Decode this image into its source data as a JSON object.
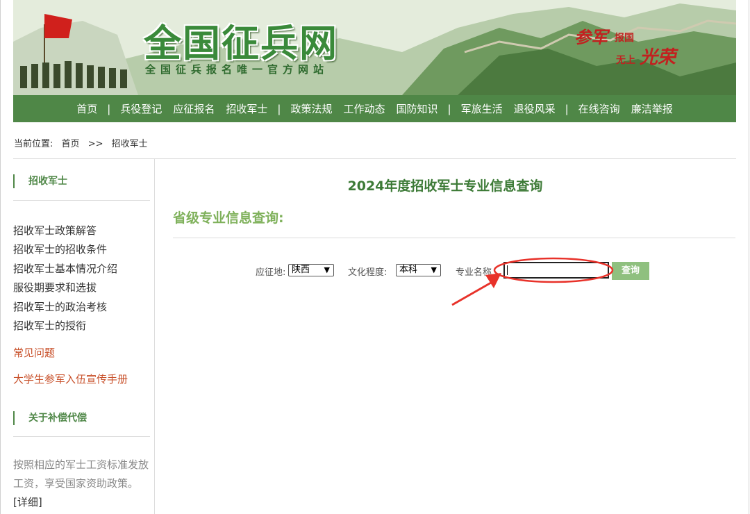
{
  "banner": {
    "site_title": "全国征兵网",
    "site_subtitle": "全国征兵报名唯一官方网站",
    "slogan_canjun": "参军",
    "slogan_baoguo": "报国",
    "slogan_wushang": "无上",
    "slogan_guangrong": "光荣"
  },
  "nav": {
    "items": [
      "首页",
      "兵役登记",
      "应征报名",
      "招收军士",
      "政策法规",
      "工作动态",
      "国防知识",
      "军旅生活",
      "退役风采",
      "在线咨询",
      "廉洁举报"
    ],
    "separator": "|"
  },
  "breadcrumb": {
    "label": "当前位置:",
    "home": "首页",
    "sep": ">>",
    "current": "招收军士"
  },
  "sidebar": {
    "section1_title": "招收军士",
    "links": [
      "招收军士政策解答",
      "招收军士的招收条件",
      "招收军士基本情况介绍",
      "服役期要求和选拔",
      "招收军士的政治考核",
      "招收军士的授衔"
    ],
    "faq": "常见问题",
    "handbook": "大学生参军入伍宣传手册",
    "section2_title": "关于补偿代偿",
    "section2_text": "按照相应的军士工资标准发放工资，享受国家资助政策。",
    "detail_link": "[详细]"
  },
  "main": {
    "title": "2024年度招收军士专业信息查询",
    "subtitle": "省级专业信息查询:",
    "form": {
      "region_label": "应征地:",
      "region_value": "陕西",
      "edu_label": "文化程度:",
      "edu_value": "本科",
      "major_label": "专业名称",
      "major_value": "",
      "query_button": "查询"
    }
  },
  "colors": {
    "nav_green": "#4f8747",
    "title_green": "#3c7a36",
    "subtitle_green": "#7fb15b",
    "button_green": "#8fc07f",
    "annotation_red": "#e8322a"
  }
}
